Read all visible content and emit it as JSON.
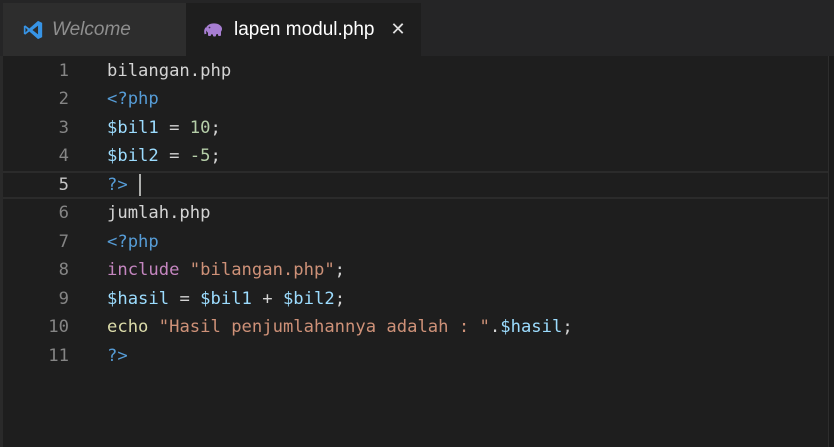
{
  "tabs": {
    "welcome": {
      "label": "Welcome",
      "icon": "vscode-logo-icon"
    },
    "active": {
      "label": "lapen modul.php",
      "icon": "php-elephant-icon",
      "close": "✕"
    }
  },
  "editor": {
    "current_line": 5,
    "colors": {
      "background": "#1e1e1e",
      "tag": "#569cd6",
      "variable": "#9cdcfe",
      "number": "#b5cea8",
      "string": "#ce9178",
      "keyword": "#c586c0",
      "function": "#dcdcaa"
    },
    "lines": [
      {
        "number": "1",
        "tokens": [
          {
            "t": "plain",
            "text": "bilangan.php"
          }
        ]
      },
      {
        "number": "2",
        "tokens": [
          {
            "t": "tag",
            "text": "<?php"
          }
        ]
      },
      {
        "number": "3",
        "tokens": [
          {
            "t": "var",
            "text": "$bil1"
          },
          {
            "t": "plain",
            "text": " = "
          },
          {
            "t": "num",
            "text": "10"
          },
          {
            "t": "plain",
            "text": ";"
          }
        ]
      },
      {
        "number": "4",
        "tokens": [
          {
            "t": "var",
            "text": "$bil2"
          },
          {
            "t": "plain",
            "text": " = "
          },
          {
            "t": "num",
            "text": "-5"
          },
          {
            "t": "plain",
            "text": ";"
          }
        ]
      },
      {
        "number": "5",
        "tokens": [
          {
            "t": "tag",
            "text": "?>"
          }
        ]
      },
      {
        "number": "6",
        "tokens": [
          {
            "t": "plain",
            "text": "jumlah.php"
          }
        ]
      },
      {
        "number": "7",
        "tokens": [
          {
            "t": "tag",
            "text": "<?php"
          }
        ]
      },
      {
        "number": "8",
        "tokens": [
          {
            "t": "kw",
            "text": "include"
          },
          {
            "t": "plain",
            "text": " "
          },
          {
            "t": "str",
            "text": "\"bilangan.php\""
          },
          {
            "t": "plain",
            "text": ";"
          }
        ]
      },
      {
        "number": "9",
        "tokens": [
          {
            "t": "var",
            "text": "$hasil"
          },
          {
            "t": "plain",
            "text": " = "
          },
          {
            "t": "var",
            "text": "$bil1"
          },
          {
            "t": "plain",
            "text": " + "
          },
          {
            "t": "var",
            "text": "$bil2"
          },
          {
            "t": "plain",
            "text": ";"
          }
        ]
      },
      {
        "number": "10",
        "tokens": [
          {
            "t": "fn",
            "text": "echo"
          },
          {
            "t": "plain",
            "text": " "
          },
          {
            "t": "str",
            "text": "\"Hasil penjumlahannya adalah : \""
          },
          {
            "t": "plain",
            "text": "."
          },
          {
            "t": "var",
            "text": "$hasil"
          },
          {
            "t": "plain",
            "text": ";"
          }
        ]
      },
      {
        "number": "11",
        "tokens": [
          {
            "t": "tag",
            "text": "?>"
          }
        ]
      }
    ]
  }
}
